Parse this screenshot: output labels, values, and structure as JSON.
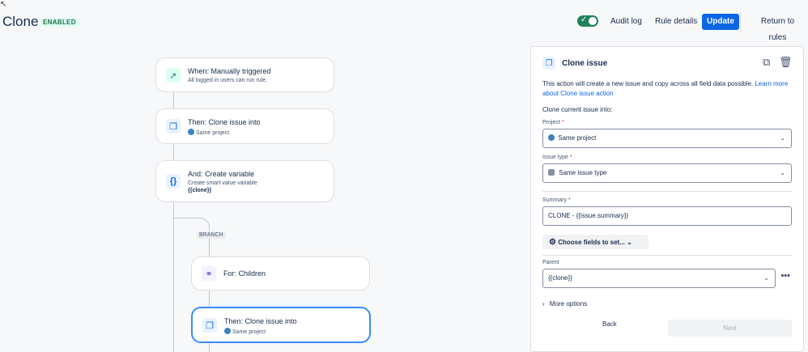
{
  "header": {
    "title": "Clone",
    "badge": "ENABLED",
    "toggle_on": true,
    "audit_log": "Audit log",
    "rule_details": "Rule details",
    "update": "Update",
    "return_to_rules": "Return to rules"
  },
  "flow": {
    "trigger": {
      "title": "When: Manually triggered",
      "subtitle": "All logged in users can run rule."
    },
    "clone1": {
      "title": "Then: Clone issue into",
      "subtitle": "Same project"
    },
    "variable": {
      "title": "And: Create variable",
      "subtitle": "Create smart value variable",
      "value": "{{clone}}"
    },
    "branch_label": "BRANCH",
    "for_children": {
      "title": "For: Children"
    },
    "clone2": {
      "title": "Then: Clone issue into",
      "subtitle": "Same project"
    }
  },
  "panel": {
    "title": "Clone issue",
    "description": "This action will create a new issue and copy across all field data possible. ",
    "learn_more": "Learn more about Clone issue action",
    "clone_into": "Clone current issue into:",
    "project_label": "Project",
    "project_value": "Same project",
    "issue_type_label": "Issue type",
    "issue_type_value": "Same issue type",
    "summary_label": "Summary",
    "summary_value": "CLONE - {{issue.summary}}",
    "choose_fields": "Choose fields to set...",
    "parent_label": "Parent",
    "parent_value": "{{clone}}",
    "more_options": "More options",
    "back": "Back",
    "next": "Next",
    "required_mark": "*"
  }
}
